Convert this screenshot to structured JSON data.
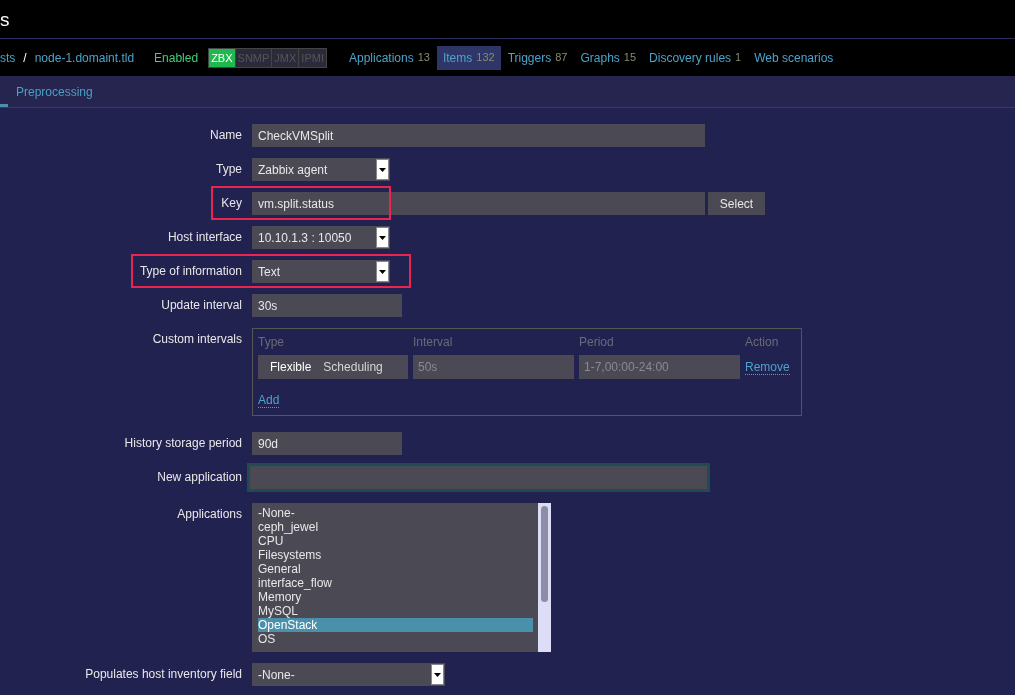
{
  "header": {
    "title": "s"
  },
  "nav": {
    "breadcrumb": [
      "sts",
      "node-1.domaint.tld"
    ],
    "separator": "/",
    "status": "Enabled",
    "availability": [
      {
        "label": "ZBX",
        "on": true
      },
      {
        "label": "SNMP",
        "on": false
      },
      {
        "label": "JMX",
        "on": false
      },
      {
        "label": "IPMI",
        "on": false
      }
    ],
    "tabs": [
      {
        "label": "Applications",
        "count": "13",
        "selected": false
      },
      {
        "label": "Items",
        "count": "132",
        "selected": true
      },
      {
        "label": "Triggers",
        "count": "87",
        "selected": false
      },
      {
        "label": "Graphs",
        "count": "15",
        "selected": false
      },
      {
        "label": "Discovery rules",
        "count": "1",
        "selected": false
      },
      {
        "label": "Web scenarios",
        "selected": false
      }
    ]
  },
  "subtabs": [
    {
      "label": "Preprocessing",
      "selected": false
    }
  ],
  "form": [
    {
      "kind": "text",
      "label": "Name",
      "value": "CheckVMSplit",
      "highlighted": false
    },
    {
      "kind": "select",
      "label": "Type",
      "value": "Zabbix agent",
      "highlighted": false
    },
    {
      "kind": "text_button",
      "label": "Key",
      "value": "vm.split.status",
      "button": "Select",
      "highlighted": true
    },
    {
      "kind": "select",
      "label": "Host interface",
      "value": "10.10.1.3 : 10050",
      "highlighted": false
    },
    {
      "kind": "select",
      "label": "Type of information",
      "value": "Text",
      "highlighted": true
    },
    {
      "kind": "short_text",
      "label": "Update interval",
      "value": "30s",
      "highlighted": false
    },
    {
      "kind": "custom_intervals",
      "label": "Custom intervals",
      "columns": [
        "Type",
        "Interval",
        "Period",
        "Action"
      ],
      "rows": [
        {
          "modes": [
            {
              "label": "Flexible",
              "selected": true
            },
            {
              "label": "Scheduling",
              "selected": false
            }
          ],
          "interval": "50s",
          "period": "1-7,00:00-24:00",
          "action": "Remove"
        }
      ],
      "add": "Add",
      "highlighted": false
    },
    {
      "kind": "short_text",
      "label": "History storage period",
      "value": "90d",
      "highlighted": false
    },
    {
      "kind": "focused_text",
      "label": "New application",
      "highlighted": false
    },
    {
      "kind": "listbox",
      "label": "Applications",
      "options": [
        {
          "label": "-None-",
          "selected": false
        },
        {
          "label": "ceph_jewel",
          "selected": false
        },
        {
          "label": "CPU",
          "selected": false
        },
        {
          "label": "Filesystems",
          "selected": false
        },
        {
          "label": "General",
          "selected": false
        },
        {
          "label": "interface_flow",
          "selected": false
        },
        {
          "label": "Memory",
          "selected": false
        },
        {
          "label": "MySQL",
          "selected": false
        },
        {
          "label": "OpenStack",
          "selected": true
        },
        {
          "label": "OS",
          "selected": false
        }
      ],
      "highlighted": false
    },
    {
      "kind": "select_wide",
      "label": "Populates host inventory field",
      "value": "-None-",
      "highlighted": false
    }
  ]
}
